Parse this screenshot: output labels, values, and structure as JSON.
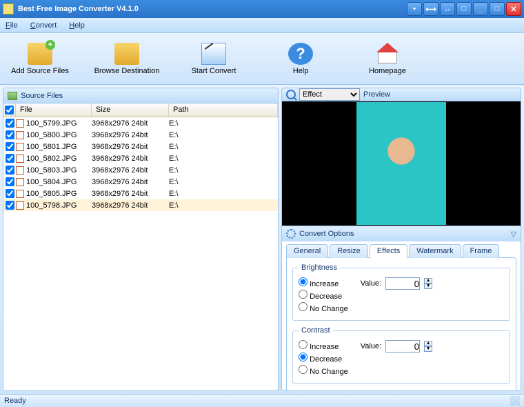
{
  "window": {
    "title": "Best Free Image Converter V4.1.0"
  },
  "menu": {
    "file": "File",
    "convert": "Convert",
    "help": "Help"
  },
  "toolbar": {
    "addSource": "Add Source Files",
    "browseDest": "Browse Destination",
    "startConvert": "Start Convert",
    "help": "Help",
    "homepage": "Homepage"
  },
  "sourcePanel": {
    "title": "Source Files",
    "cols": {
      "file": "File",
      "size": "Size",
      "path": "Path"
    },
    "files": [
      {
        "checked": true,
        "name": "100_5799.JPG",
        "dims": "3968x2976",
        "depth": "24bit",
        "path": "E:\\",
        "sel": false
      },
      {
        "checked": true,
        "name": "100_5800.JPG",
        "dims": "3968x2976",
        "depth": "24bit",
        "path": "E:\\",
        "sel": false
      },
      {
        "checked": true,
        "name": "100_5801.JPG",
        "dims": "3968x2976",
        "depth": "24bit",
        "path": "E:\\",
        "sel": false
      },
      {
        "checked": true,
        "name": "100_5802.JPG",
        "dims": "3968x2976",
        "depth": "24bit",
        "path": "E:\\",
        "sel": false
      },
      {
        "checked": true,
        "name": "100_5803.JPG",
        "dims": "3968x2976",
        "depth": "24bit",
        "path": "E:\\",
        "sel": false
      },
      {
        "checked": true,
        "name": "100_5804.JPG",
        "dims": "3968x2976",
        "depth": "24bit",
        "path": "E:\\",
        "sel": false
      },
      {
        "checked": true,
        "name": "100_5805.JPG",
        "dims": "3968x2976",
        "depth": "24bit",
        "path": "E:\\",
        "sel": false
      },
      {
        "checked": true,
        "name": "100_5798.JPG",
        "dims": "3968x2976",
        "depth": "24bit",
        "path": "E:\\",
        "sel": true
      }
    ]
  },
  "previewPanel": {
    "dropdown": "Effect",
    "label": "Preview"
  },
  "convertOptions": {
    "title": "Convert Options",
    "tabs": {
      "general": "General",
      "resize": "Resize",
      "effects": "Effects",
      "watermark": "Watermark",
      "frame": "Frame"
    },
    "activeTab": "effects",
    "brightness": {
      "legend": "Brightness",
      "increase": "Increase",
      "decrease": "Decrease",
      "nochange": "No Change",
      "selected": "increase",
      "valueLabel": "Value:",
      "value": "0"
    },
    "contrast": {
      "legend": "Contrast",
      "increase": "Increase",
      "decrease": "Decrease",
      "nochange": "No Change",
      "selected": "decrease",
      "valueLabel": "Value:",
      "value": "0"
    }
  },
  "status": {
    "text": "Ready"
  }
}
